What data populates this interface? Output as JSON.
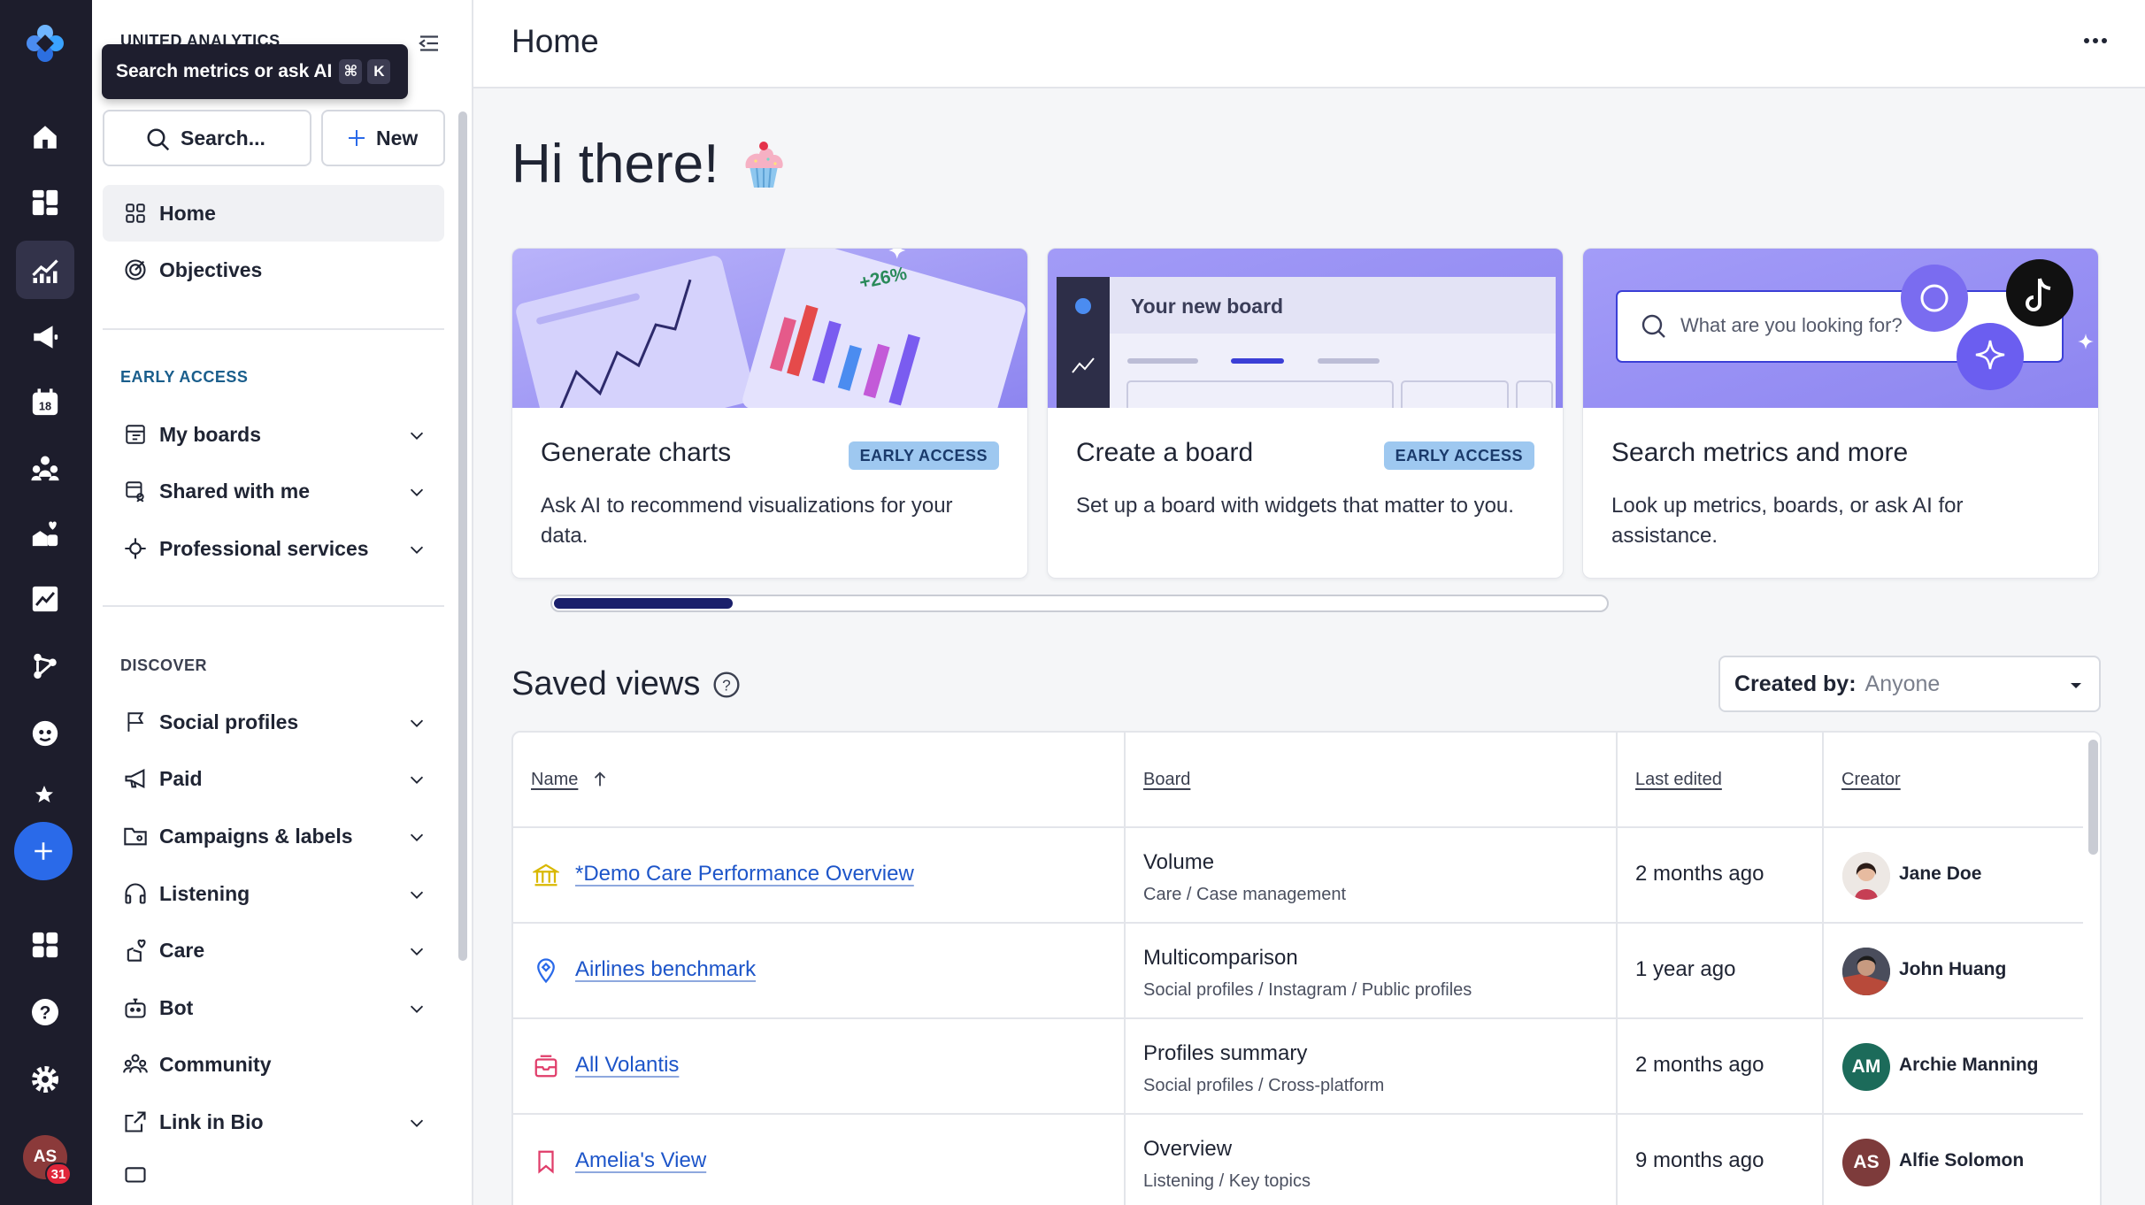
{
  "colors": {
    "rail_bg": "#1d1d2c",
    "accent_blue": "#2a6ae9",
    "link": "#1d55c9",
    "badge_bg": "#9ec8f0",
    "hero_purple": "#8d85f0"
  },
  "sidebar": {
    "workspace": "UNITED ANALYTICS",
    "tooltip": {
      "text": "Search metrics or ask AI",
      "key1": "⌘",
      "key2": "K"
    },
    "search_label": "Search...",
    "new_label": "New",
    "nav_top": [
      {
        "label": "Home",
        "icon": "grid-icon"
      },
      {
        "label": "Objectives",
        "icon": "target-icon"
      }
    ],
    "early_access_heading": "EARLY ACCESS",
    "early_items": [
      {
        "label": "My boards",
        "icon": "board-icon"
      },
      {
        "label": "Shared with me",
        "icon": "shared-board-icon"
      },
      {
        "label": "Professional services",
        "icon": "services-icon"
      }
    ],
    "discover_heading": "DISCOVER",
    "discover_items": [
      {
        "label": "Social profiles",
        "icon": "flag-icon"
      },
      {
        "label": "Paid",
        "icon": "megaphone-icon"
      },
      {
        "label": "Campaigns & labels",
        "icon": "folder-icon"
      },
      {
        "label": "Listening",
        "icon": "headphones-icon"
      },
      {
        "label": "Care",
        "icon": "care-icon"
      },
      {
        "label": "Bot",
        "icon": "bot-icon"
      },
      {
        "label": "Community",
        "icon": "community-icon"
      },
      {
        "label": "Link in Bio",
        "icon": "link-icon"
      }
    ]
  },
  "main": {
    "page_title": "Home",
    "greeting": "Hi there!",
    "cards": [
      {
        "title": "Generate charts",
        "badge": "EARLY ACCESS",
        "desc": "Ask AI to recommend visualizations for your data.",
        "hero_stat": "+26%"
      },
      {
        "title": "Create a board",
        "badge": "EARLY ACCESS",
        "desc": "Set up a board with widgets that matter to you.",
        "hero_text": "Your new board"
      },
      {
        "title": "Search metrics and more",
        "badge": "",
        "desc": "Look up metrics, boards, or ask AI for assistance.",
        "hero_placeholder": "What are you looking for?"
      }
    ],
    "carousel_progress": 0.17,
    "saved_views": {
      "title": "Saved views",
      "filter_label": "Created by:",
      "filter_value": "Anyone",
      "columns": {
        "name": "Name",
        "board": "Board",
        "edited": "Last edited",
        "creator": "Creator"
      },
      "rows": [
        {
          "name": "*Demo Care Performance Overview",
          "board": "Volume",
          "path": "Care / Case management",
          "edited": "2 months ago",
          "creator": "Jane Doe",
          "initials": "",
          "icon": "museum-icon"
        },
        {
          "name": "Airlines benchmark",
          "board": "Multicomparison",
          "path": "Social profiles / Instagram / Public profiles",
          "edited": "1 year ago",
          "creator": "John Huang",
          "initials": "",
          "icon": "location-pin-icon"
        },
        {
          "name": "All Volantis",
          "board": "Profiles summary",
          "path": "Social profiles / Cross-platform",
          "edited": "2 months ago",
          "creator": "Archie Manning",
          "initials": "AM",
          "icon": "inbox-icon"
        },
        {
          "name": "Amelia's View",
          "board": "Overview",
          "path": "Listening / Key topics",
          "edited": "9 months ago",
          "creator": "Alfie Solomon",
          "initials": "AS",
          "icon": "bookmark-icon"
        }
      ]
    }
  },
  "rail": {
    "avatar_initials": "AS",
    "notification_count": "31"
  }
}
